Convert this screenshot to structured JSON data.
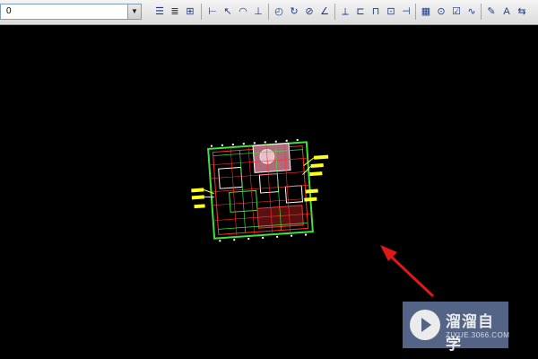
{
  "toolbar": {
    "layer_value": "0",
    "icons": [
      "layer-manager-icon",
      "layer-state-icon",
      "layer-properties-icon",
      "linear-dimension-icon",
      "aligned-dimension-icon",
      "arc-length-icon",
      "ordinate-dimension-icon",
      "radius-dimension-icon",
      "jogged-dimension-icon",
      "diameter-dimension-icon",
      "angular-dimension-icon",
      "quick-dimension-icon",
      "baseline-dimension-icon",
      "continue-dimension-icon",
      "dimension-space-icon",
      "dimension-break-icon",
      "tolerance-icon",
      "center-mark-icon",
      "inspection-icon",
      "jogged-linear-icon",
      "dimension-edit-icon",
      "dimension-text-edit-icon",
      "dimension-update-icon"
    ]
  },
  "colors": {
    "background": "#000000",
    "annotation_arrow": "#e01818",
    "plan_green": "#3fe03f",
    "plan_red": "#ff3030",
    "plan_yellow": "#ffff20",
    "plan_white": "#ffffff",
    "watermark_bg": "#5b6d93"
  },
  "watermark": {
    "title": "溜溜自学",
    "url": "ZIXUE.3066.COM"
  }
}
